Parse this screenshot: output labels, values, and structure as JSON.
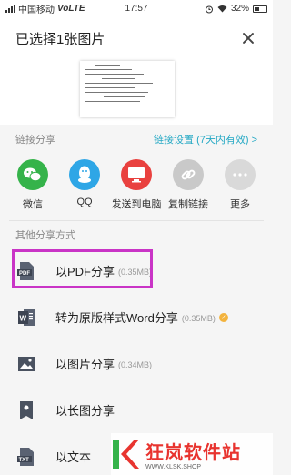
{
  "status_bar": {
    "carrier": "中国移动",
    "network": "VoLTE",
    "time": "17:57",
    "battery": "32%"
  },
  "sheet": {
    "title": "已选择1张图片"
  },
  "link_share": {
    "heading": "链接分享",
    "setting_label": "链接设置 (7天内有效) >",
    "items": [
      {
        "label": "微信",
        "icon": "wechat-icon",
        "color": "#35b34a"
      },
      {
        "label": "QQ",
        "icon": "qq-icon",
        "color": "#2ea6e6"
      },
      {
        "label": "发送到电脑",
        "icon": "computer-icon",
        "color": "#e9413f"
      },
      {
        "label": "复制链接",
        "icon": "link-icon",
        "color": "#c9c9c9"
      },
      {
        "label": "更多",
        "icon": "more-icon",
        "color": "#d9d9d9"
      }
    ]
  },
  "other_share": {
    "heading": "其他分享方式",
    "items": [
      {
        "label": "以PDF分享",
        "size": "(0.35MB)",
        "icon": "pdf-icon"
      },
      {
        "label": "转为原版样式Word分享",
        "size": "(0.35MB)",
        "icon": "word-icon"
      },
      {
        "label": "以图片分享",
        "size": "(0.34MB)",
        "icon": "image-icon"
      },
      {
        "label": "以长图分享",
        "size": "",
        "icon": "long-image-icon"
      },
      {
        "label": "以文本",
        "size": "",
        "icon": "txt-icon"
      }
    ]
  },
  "watermark": {
    "main": "狂岚软件站",
    "sub": "WWW.KLSK.SHOP"
  },
  "colors": {
    "accent": "#23a8c4",
    "highlight": "#c934c6"
  }
}
